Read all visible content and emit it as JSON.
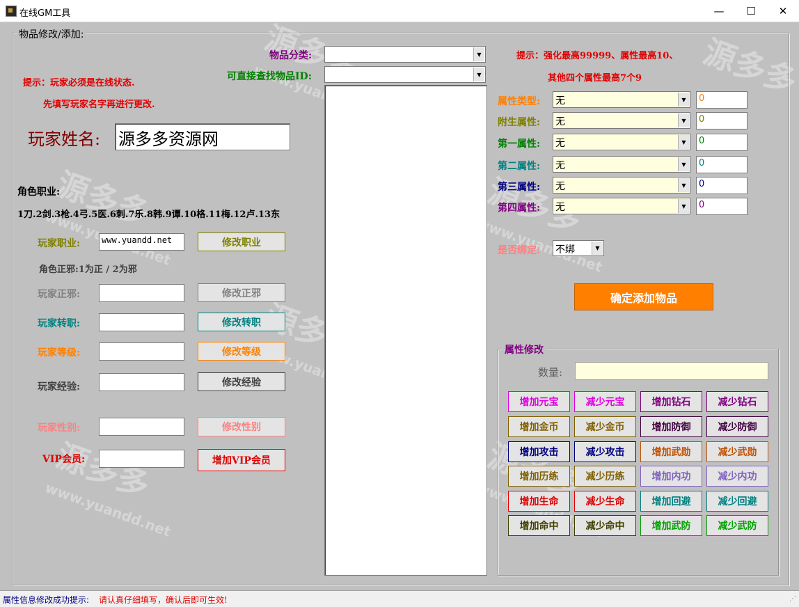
{
  "window": {
    "title": "在线GM工具",
    "minimize": "—",
    "maximize": "☐",
    "close": "✕"
  },
  "group_main": {
    "title": "物品修改/添加:"
  },
  "left": {
    "note1": "提示：玩家必须是在线状态.",
    "note2": "先填写玩家名字再进行更改.",
    "player_name_label": "玩家姓名:",
    "player_name_value": "源多多资源网",
    "role_job_title": "角色职业:",
    "role_job_list": "1刀.2剑.3枪.4弓.5医.6刺.7乐.8韩.9谭.10格.11梅.12卢.13东",
    "rows": {
      "job": {
        "label": "玩家职业:",
        "value": "www.yuandd.net",
        "button": "修改职业",
        "color": "#808000"
      },
      "zx_note": "角色正邪:1为正 / 2为邪",
      "zx": {
        "label": "玩家正邪:",
        "value": "",
        "button": "修改正邪",
        "color": "#808080"
      },
      "transfer": {
        "label": "玩家转职:",
        "value": "",
        "button": "修改转职",
        "color": "#008080"
      },
      "level": {
        "label": "玩家等级:",
        "value": "",
        "button": "修改等级",
        "color": "#ff8000"
      },
      "exp": {
        "label": "玩家经验:",
        "value": "",
        "button": "修改经验",
        "color": "#404040"
      },
      "gender": {
        "label": "玩家性别:",
        "value": "",
        "button": "修改性别",
        "color": "#ff8080"
      },
      "vip": {
        "label": "VIP会员:",
        "value": "",
        "button": "增加VIP会员",
        "color": "#e00000"
      }
    }
  },
  "middle": {
    "category_label": "物品分类:",
    "category_value": "",
    "itemid_label": "可直接查找物品ID:",
    "itemid_value": ""
  },
  "right": {
    "hint1": "提示：强化最高99999、属性最高10、",
    "hint2": "其他四个属性最高7个9",
    "attrs": [
      {
        "label": "属性类型:",
        "select": "无",
        "value": "0",
        "color": "#ff8000"
      },
      {
        "label": "附生属性:",
        "select": "无",
        "value": "0",
        "color": "#808000"
      },
      {
        "label": "第一属性:",
        "select": "无",
        "value": "0",
        "color": "#008000"
      },
      {
        "label": "第二属性:",
        "select": "无",
        "value": "0",
        "color": "#008080"
      },
      {
        "label": "第三属性:",
        "select": "无",
        "value": "0",
        "color": "#000080"
      },
      {
        "label": "第四属性:",
        "select": "无",
        "value": "0",
        "color": "#800080"
      }
    ],
    "bind_label": "是否绑定:",
    "bind_value": "不绑",
    "add_button": "确定添加物品"
  },
  "attr_modify": {
    "title": "属性修改",
    "qty_label": "数量:",
    "qty_value": "",
    "buttons": [
      {
        "label": "增加元宝",
        "color": "#e000e0"
      },
      {
        "label": "减少元宝",
        "color": "#e000e0"
      },
      {
        "label": "增加钻石",
        "color": "#800080"
      },
      {
        "label": "减少钻石",
        "color": "#800080"
      },
      {
        "label": "增加金币",
        "color": "#806000"
      },
      {
        "label": "减少金币",
        "color": "#806000"
      },
      {
        "label": "增加防御",
        "color": "#400040"
      },
      {
        "label": "减少防御",
        "color": "#400040"
      },
      {
        "label": "增加攻击",
        "color": "#000080"
      },
      {
        "label": "减少攻击",
        "color": "#000080"
      },
      {
        "label": "增加武勋",
        "color": "#c05000"
      },
      {
        "label": "减少武勋",
        "color": "#c05000"
      },
      {
        "label": "增加历练",
        "color": "#806000"
      },
      {
        "label": "减少历练",
        "color": "#806000"
      },
      {
        "label": "增加内功",
        "color": "#8060c0"
      },
      {
        "label": "减少内功",
        "color": "#8060c0"
      },
      {
        "label": "增加生命",
        "color": "#e00000"
      },
      {
        "label": "减少生命",
        "color": "#e00000"
      },
      {
        "label": "增加回避",
        "color": "#008080"
      },
      {
        "label": "减少回避",
        "color": "#008080"
      },
      {
        "label": "增加命中",
        "color": "#404000"
      },
      {
        "label": "减少命中",
        "color": "#404000"
      },
      {
        "label": "增加武防",
        "color": "#00a000"
      },
      {
        "label": "减少武防",
        "color": "#00a000"
      }
    ]
  },
  "status": {
    "label": "属性信息修改成功提示:",
    "message": "请认真仔细填写，确认后即可生效!"
  },
  "watermark": {
    "brand": "源多多",
    "url": "www.yuandd.net"
  }
}
